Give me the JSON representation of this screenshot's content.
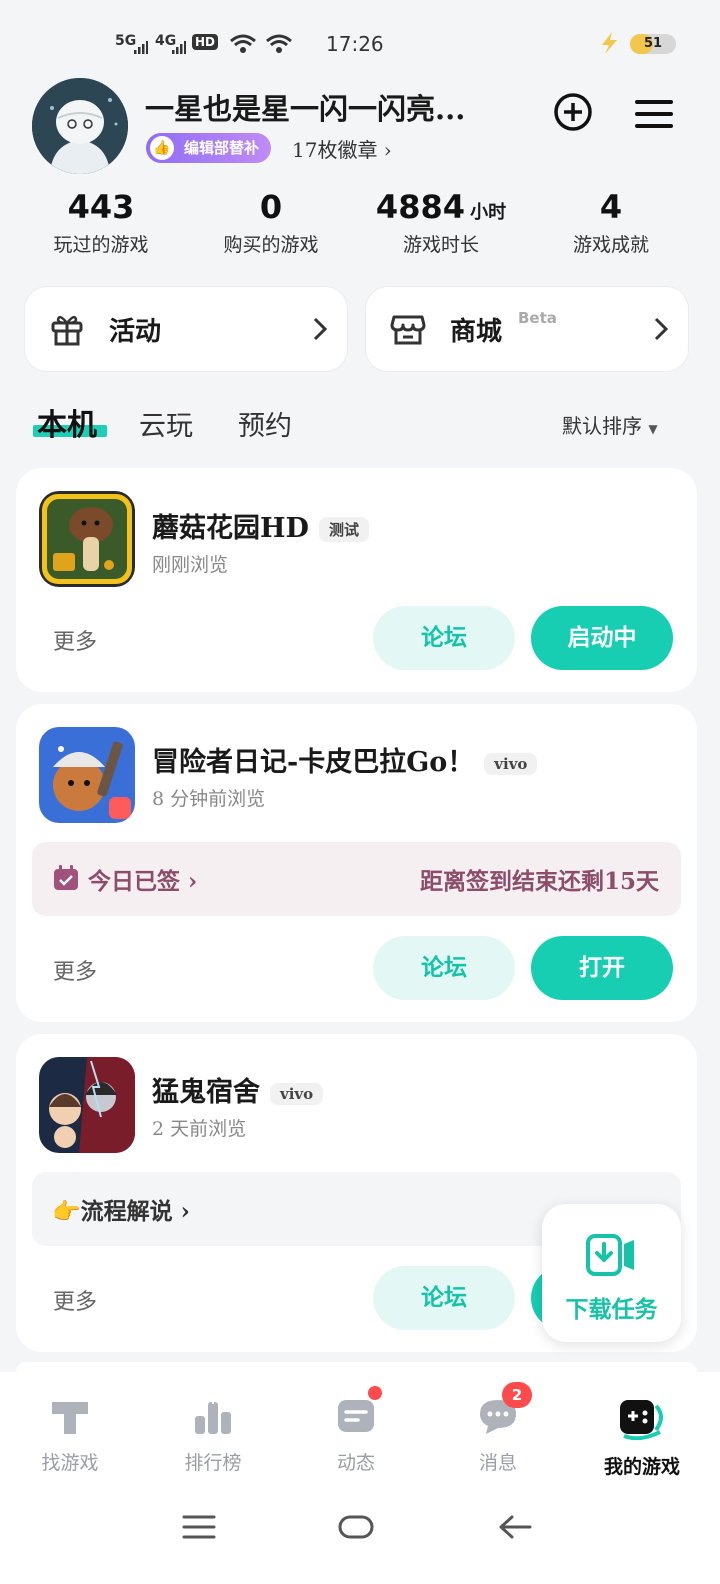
{
  "status_bar": {
    "net1": "5G",
    "net2": "4G",
    "hd": "HD",
    "time": "17:26",
    "battery": "51",
    "battery_level": 0.51
  },
  "profile": {
    "username": "一星也是星一闪一闪亮...",
    "badge": "编辑部替补",
    "medals": "17枚徽章 ›"
  },
  "stats": [
    {
      "value": "443",
      "unit": "",
      "label": "玩过的游戏"
    },
    {
      "value": "0",
      "unit": "",
      "label": "购买的游戏"
    },
    {
      "value": "4884",
      "unit": "小时",
      "label": "游戏时长"
    },
    {
      "value": "4",
      "unit": "",
      "label": "游戏成就"
    }
  ],
  "quick": {
    "activity": "活动",
    "mall": "商城",
    "mall_tag": "Beta"
  },
  "tabs": [
    {
      "label": "本机"
    },
    {
      "label": "云玩"
    },
    {
      "label": "预约"
    }
  ],
  "sort_label": "默认排序",
  "games": [
    {
      "name": "蘑菇花园HD",
      "tag": "测试",
      "subtitle": "刚刚浏览",
      "more": "更多",
      "forum": "论坛",
      "action": "启动中"
    },
    {
      "name": "冒险者日记-卡皮巴拉Go！",
      "tag": "vivo",
      "subtitle": "8 分钟前浏览",
      "strip_left": "今日已签 ›",
      "strip_right": "距离签到结束还剩15天",
      "more": "更多",
      "forum": "论坛",
      "action": "打开"
    },
    {
      "name": "猛鬼宿舍",
      "tag": "vivo",
      "subtitle": "2 天前浏览",
      "strip_left": "👉流程解说 ›",
      "more": "更多",
      "forum": "论坛"
    }
  ],
  "download": {
    "label": "下载任务"
  },
  "nav": [
    {
      "label": "找游戏"
    },
    {
      "label": "排行榜"
    },
    {
      "label": "动态"
    },
    {
      "label": "消息",
      "badge": "2"
    },
    {
      "label": "我的游戏"
    }
  ],
  "colors": {
    "accent": "#17cdb2",
    "accent_light": "#e3f8f5",
    "badge_purple": "#8f6df6",
    "notify": "#ff4b4b"
  }
}
